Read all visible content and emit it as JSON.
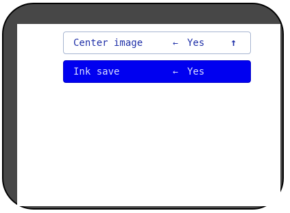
{
  "menu": {
    "items": [
      {
        "label": "Center image",
        "value": "Yes",
        "arrow": "←"
      },
      {
        "label": "Ink save",
        "value": "Yes",
        "arrow": "←"
      }
    ],
    "selected_index": 1,
    "scroll_indicator": "↑"
  },
  "colors": {
    "bezel": "#474747",
    "highlight": "#0000f0",
    "text": "#1e2fa8"
  }
}
